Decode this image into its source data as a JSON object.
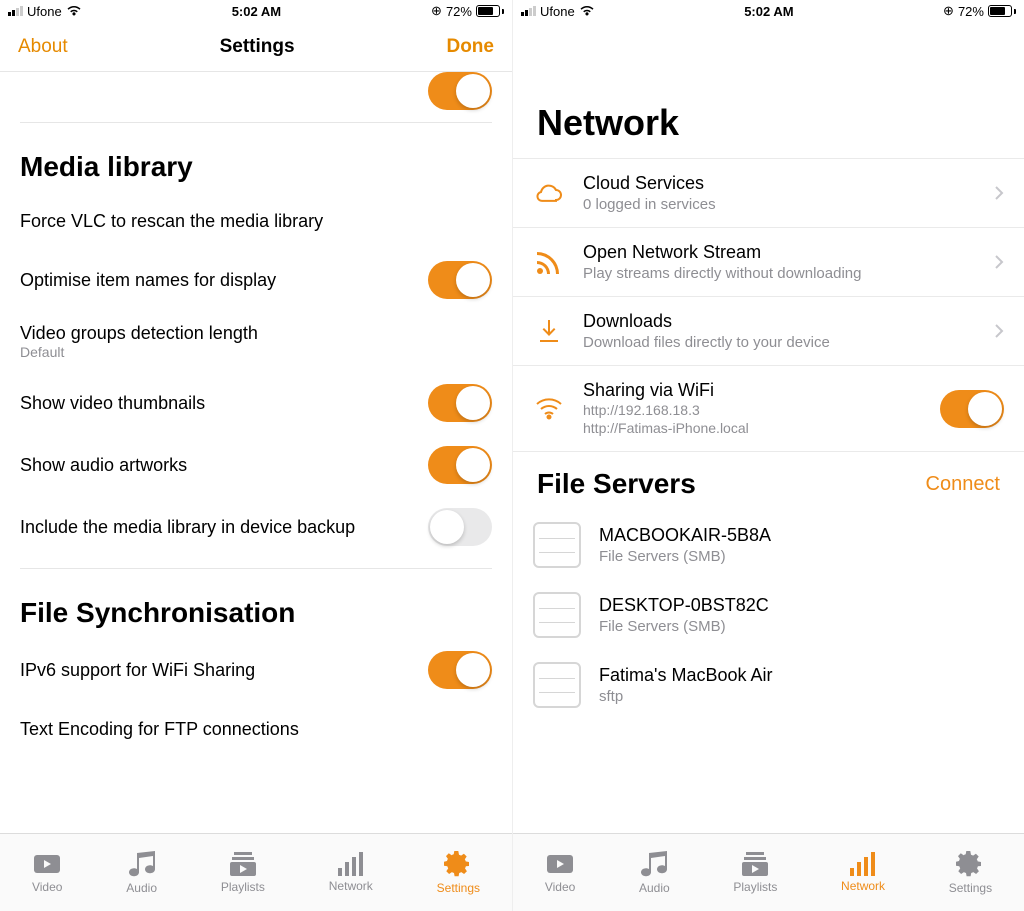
{
  "status": {
    "carrier": "Ufone",
    "time": "5:02 AM",
    "battery_pct": "72%"
  },
  "left": {
    "about_btn": "About",
    "title": "Settings",
    "done_btn": "Done",
    "sections": {
      "media_library": "Media library",
      "rows": {
        "rescan": "Force VLC to rescan the media library",
        "optimise": "Optimise item names for display",
        "groups": "Video groups detection length",
        "groups_sub": "Default",
        "thumbs": "Show video thumbnails",
        "artworks": "Show audio artworks",
        "backup": "Include the media library in device backup"
      },
      "file_sync": "File Synchronisation",
      "sync_rows": {
        "ipv6": "IPv6 support for WiFi Sharing",
        "encoding": "Text Encoding for FTP connections"
      }
    }
  },
  "right": {
    "title": "Network",
    "items": {
      "cloud": {
        "title": "Cloud Services",
        "sub": "0 logged in services"
      },
      "stream": {
        "title": "Open Network Stream",
        "sub": "Play streams directly without downloading"
      },
      "downloads": {
        "title": "Downloads",
        "sub": "Download files directly to your device"
      },
      "wifi": {
        "title": "Sharing via WiFi",
        "sub1": "http://192.168.18.3",
        "sub2": "http://Fatimas-iPhone.local"
      }
    },
    "file_servers": {
      "header": "File Servers",
      "connect": "Connect",
      "servers": [
        {
          "name": "MACBOOKAIR-5B8A",
          "type": "File Servers (SMB)"
        },
        {
          "name": "DESKTOP-0BST82C",
          "type": "File Servers (SMB)"
        },
        {
          "name": "Fatima's MacBook Air",
          "type": "sftp"
        }
      ]
    }
  },
  "tabs": {
    "video": "Video",
    "audio": "Audio",
    "playlists": "Playlists",
    "network": "Network",
    "settings": "Settings"
  }
}
